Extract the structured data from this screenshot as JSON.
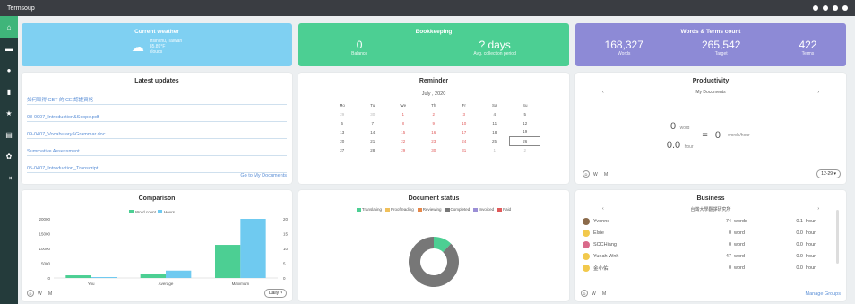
{
  "app": {
    "title": "Termsoup"
  },
  "sidebar": {
    "items": [
      "home",
      "folder",
      "person",
      "document",
      "star",
      "calendar",
      "settings",
      "logout"
    ]
  },
  "weather": {
    "title": "Current weather",
    "location": "Hsinchu, Taiwan",
    "temp": "85.89°F",
    "condition": "clouds"
  },
  "bookkeeping": {
    "title": "Bookkeeping",
    "balance_value": "0",
    "balance_label": "Balance",
    "days_value": "? days",
    "days_label": "Avg. collection period"
  },
  "words": {
    "title": "Words & Terms count",
    "items": [
      {
        "value": "168,327",
        "label": "Words"
      },
      {
        "value": "265,542",
        "label": "Target"
      },
      {
        "value": "422",
        "label": "Terms"
      }
    ]
  },
  "updates": {
    "title": "Latest updates",
    "items": [
      "如何取得 CBT 的 CE 認證資格",
      "08-0907_Introduction&Scope.pdf",
      "09-0407_Vocabulary&Grammar.doc",
      "Summative Assessment",
      "05-0407_Introduction_Transcript"
    ],
    "footer": "Go to My Documents"
  },
  "reminder": {
    "title": "Reminder",
    "month": "July , 2020",
    "weekdays": [
      "Mo",
      "Tu",
      "We",
      "Th",
      "Fr",
      "Sa",
      "Su"
    ],
    "weeks": [
      [
        "29",
        "30",
        "1",
        "2",
        "3",
        "4",
        "5"
      ],
      [
        "6",
        "7",
        "8",
        "9",
        "10",
        "11",
        "12"
      ],
      [
        "13",
        "14",
        "15",
        "16",
        "17",
        "18",
        "19"
      ],
      [
        "20",
        "21",
        "22",
        "23",
        "24",
        "25",
        "26"
      ],
      [
        "27",
        "28",
        "29",
        "30",
        "31",
        "1",
        "2"
      ]
    ]
  },
  "productivity": {
    "title": "Productivity",
    "subtitle": "My Documents",
    "num_value": "0",
    "num_unit": "word",
    "den_value": "0.0",
    "den_unit": "hour",
    "result_value": "0",
    "result_unit": "words/hour",
    "tabs": [
      "D",
      "W",
      "M"
    ],
    "dropdown": "12-29"
  },
  "comparison": {
    "title": "Comparison",
    "tabs": [
      "D",
      "W",
      "M"
    ],
    "dropdown": "Daily"
  },
  "chart_data": {
    "type": "bar",
    "title": "Comparison",
    "categories": [
      "You",
      "Average",
      "Maximum"
    ],
    "series": [
      {
        "name": "Word count",
        "values": [
          900,
          1500,
          11200
        ],
        "color": "#4ccf93"
      },
      {
        "name": "Hours",
        "values": [
          0.3,
          2.5,
          20
        ],
        "color": "#6fcaf0"
      }
    ],
    "ylim": [
      0,
      20000
    ],
    "y2lim": [
      0,
      20
    ],
    "yticks": [
      "20000",
      "15000",
      "10000",
      "5000",
      "0"
    ],
    "y2ticks": [
      "20",
      "15",
      "10",
      "5",
      "0"
    ]
  },
  "docstatus": {
    "title": "Document status",
    "legend": [
      {
        "label": "Translating",
        "color": "#4ccf93"
      },
      {
        "label": "Proofreading",
        "color": "#f0c05a"
      },
      {
        "label": "Reviewing",
        "color": "#e5884a"
      },
      {
        "label": "Completed",
        "color": "#777777"
      },
      {
        "label": "Invoiced",
        "color": "#9b8fd6"
      },
      {
        "label": "Paid",
        "color": "#e05a5a"
      }
    ],
    "values": [
      0.12,
      0,
      0,
      0.88,
      0,
      0
    ]
  },
  "business": {
    "title": "Business",
    "subtitle": "台灣大學翻譯研究所",
    "rows": [
      {
        "name": "Yvonne",
        "words": "74",
        "wunit": "words",
        "hours": "0.1",
        "hunit": "hour"
      },
      {
        "name": "Elsie",
        "words": "0",
        "wunit": "word",
        "hours": "0.0",
        "hunit": "hour"
      },
      {
        "name": "SCCHiang",
        "words": "0",
        "wunit": "word",
        "hours": "0.0",
        "hunit": "hour"
      },
      {
        "name": "Yueah Wnh",
        "words": "47",
        "wunit": "word",
        "hours": "0.0",
        "hunit": "hour"
      },
      {
        "name": "金小佑",
        "words": "0",
        "wunit": "word",
        "hours": "0.0",
        "hunit": "hour"
      }
    ],
    "tabs": [
      "D",
      "W",
      "M"
    ],
    "footer": "Manage Groups"
  }
}
